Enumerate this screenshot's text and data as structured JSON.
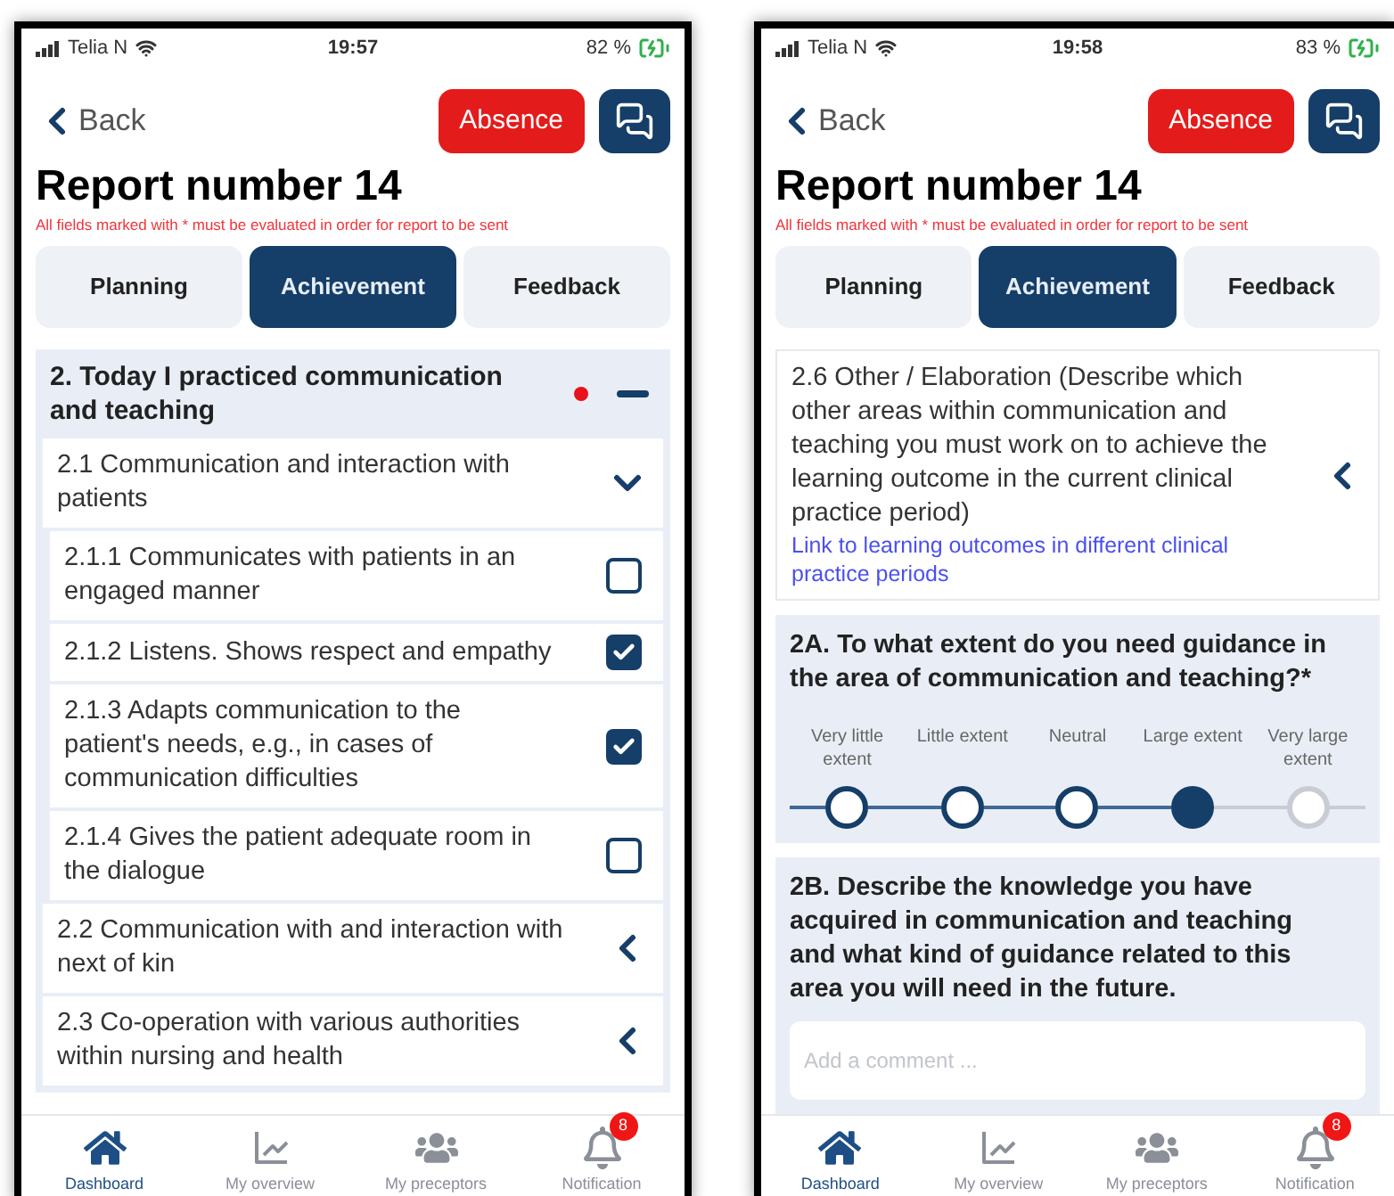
{
  "phones": [
    {
      "status": {
        "carrier": "Telia N",
        "time": "19:57",
        "battery": "82 %"
      },
      "back": "Back",
      "absence": "Absence",
      "title": "Report number 14",
      "notice": "All fields marked with * must be evaluated in order for report to be sent",
      "tabs": [
        {
          "label": "Planning",
          "selected": false
        },
        {
          "label": "Achievement",
          "selected": true
        },
        {
          "label": "Feedback",
          "selected": false
        }
      ],
      "blocks": [
        {
          "kind": "section",
          "title": "2. Today I practiced communication and teaching",
          "flagged": true,
          "expanded": true,
          "children": [
            {
              "title": "2.1 Communication and interaction with patients",
              "expanded": true,
              "children": [
                {
                  "label": "2.1.1 Communicates with patients in an engaged manner",
                  "checked": false
                },
                {
                  "label": "2.1.2 Listens. Shows respect and empathy",
                  "checked": true
                },
                {
                  "label": "2.1.3 Adapts communication to the patient's needs, e.g., in cases of communication difficulties",
                  "checked": true
                },
                {
                  "label": "2.1.4 Gives the patient adequate room in the dialogue",
                  "checked": false
                }
              ]
            },
            {
              "title": "2.2 Communication with and interaction with next of kin",
              "expanded": false
            },
            {
              "title": "2.3 Co-operation with various authorities within nursing and health",
              "expanded": false
            }
          ]
        }
      ],
      "nav": [
        {
          "label": "Dashboard",
          "selected": true
        },
        {
          "label": "My overview",
          "selected": false
        },
        {
          "label": "My preceptors",
          "selected": false
        },
        {
          "label": "Notification",
          "selected": false,
          "badge": "8"
        }
      ]
    },
    {
      "status": {
        "carrier": "Telia N",
        "time": "19:58",
        "battery": "83 %"
      },
      "back": "Back",
      "absence": "Absence",
      "title": "Report number 14",
      "notice": "All fields marked with * must be evaluated in order for report to be sent",
      "tabs": [
        {
          "label": "Planning",
          "selected": false
        },
        {
          "label": "Achievement",
          "selected": true
        },
        {
          "label": "Feedback",
          "selected": false
        }
      ],
      "blocks": [
        {
          "kind": "item",
          "title": "2.6 Other / Elaboration (Describe which other areas within communication and teaching you must work on to achieve the learning outcome in the current clinical practice period)",
          "link": "Link to learning outcomes in different clinical practice periods",
          "expanded": false
        },
        {
          "kind": "scale",
          "question": "2A. To what extent do you need guidance in the area of communication and teaching?*",
          "options": [
            {
              "label": "Very little extent",
              "selected": false
            },
            {
              "label": "Little extent",
              "selected": false
            },
            {
              "label": "Neutral",
              "selected": false
            },
            {
              "label": "Large extent",
              "selected": true
            },
            {
              "label": "Very large extent",
              "selected": false
            }
          ]
        },
        {
          "kind": "comment",
          "question": "2B. Describe the knowledge you have acquired in communication and teaching and what kind of guidance related to this area you will need in the future.",
          "placeholder": "Add a comment ..."
        }
      ],
      "nav": [
        {
          "label": "Dashboard",
          "selected": true
        },
        {
          "label": "My overview",
          "selected": false
        },
        {
          "label": "My preceptors",
          "selected": false
        },
        {
          "label": "Notification",
          "selected": false,
          "badge": "8"
        }
      ]
    }
  ]
}
